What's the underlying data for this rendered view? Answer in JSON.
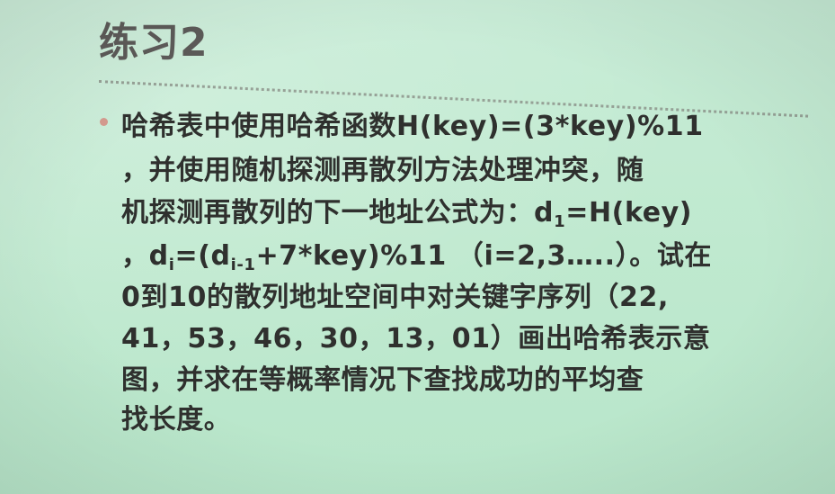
{
  "slide": {
    "title": "练习2",
    "lines": [
      "哈希表中使用哈希函数H(key)=(3*key)%11",
      "，并使用随机探测再散列方法处理冲突，随",
      "机探测再散列的下一地址公式为：",
      "，",
      "0到10的散列地址空间中对关键字序列（22,",
      "41，53，46，30，13，01）画出哈希表示意",
      "图，并求在等概率情况下查找成功的平均查",
      "找长度。"
    ],
    "formula1": {
      "d": "d",
      "sub": "1",
      "rest": "=H(key)"
    },
    "formula2": {
      "d1": "d",
      "sub1": "i",
      "mid": "=(d",
      "sub2": "i-1",
      "rest": "+7*key)%11  （i=2,3…..）。试在"
    }
  },
  "colors": {
    "background": "#c7ecd6",
    "title_text": "#5d5b59",
    "body_text": "#2f302e",
    "bullet": "#d59b8f",
    "divider": "#8a8f87"
  }
}
